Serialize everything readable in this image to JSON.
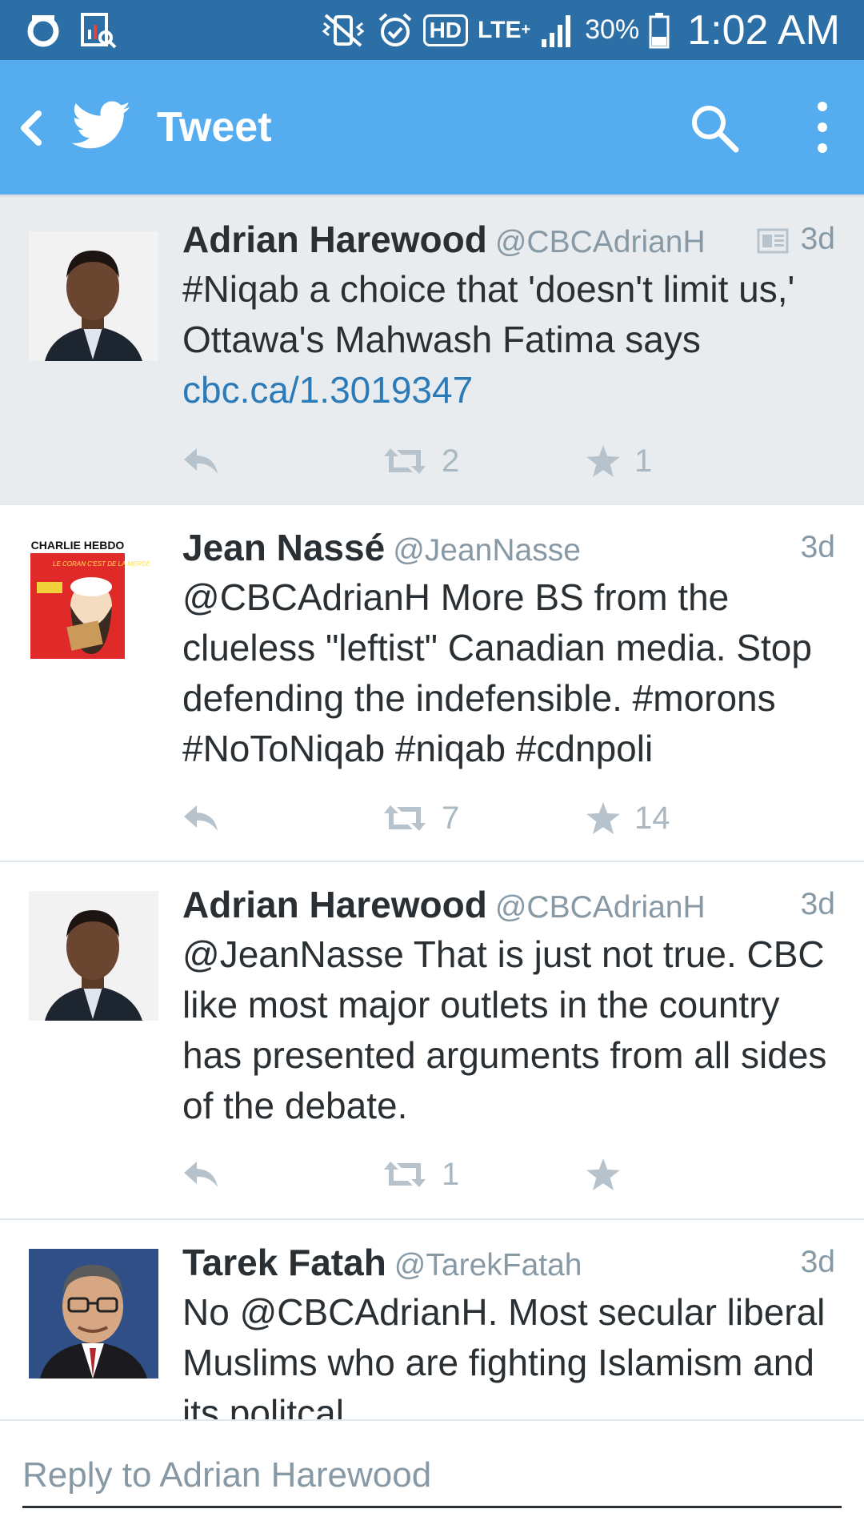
{
  "status_bar": {
    "hd_label": "HD",
    "network_label": "LTE",
    "network_sup": "+",
    "battery_percent": "30%",
    "battery_level": 0.3,
    "clock": "1:02 AM"
  },
  "app_bar": {
    "title": "Tweet",
    "back_icon": "chevron-left-icon",
    "logo_icon": "twitter-bird-icon",
    "search_icon": "search-icon",
    "menu_icon": "overflow-menu-icon",
    "background": "#55acee"
  },
  "tweets": [
    {
      "name": "Adrian Harewood",
      "handle": "@CBCAdrianH",
      "time": "3d",
      "text": "#Niqab a choice that 'doesn't limit us,' Ottawa's Mahwash Fatima says",
      "link": "cbc.ca/1.3019347",
      "retweets": "2",
      "favorites": "1",
      "avatar": "man-portrait-icon"
    },
    {
      "name": "Jean Nassé",
      "handle": "@JeanNasse",
      "time": "3d",
      "text": "@CBCAdrianH More BS from the clueless \"leftist\" Canadian media. Stop defending the indefensible. #morons #NoToNiqab #niqab #cdnpoli",
      "retweets": "7",
      "favorites": "14",
      "avatar": "magazine-cover-icon",
      "avatar_masthead": "CHARLIE HEBDO",
      "avatar_caption": "LE CORAN C'EST DE LA MERDE"
    },
    {
      "name": "Adrian Harewood",
      "handle": "@CBCAdrianH",
      "time": "3d",
      "text": "@JeanNasse That is just not true. CBC like most major outlets in the country has presented arguments from all sides of the debate.",
      "retweets": "1",
      "favorites": "",
      "avatar": "man-portrait-icon"
    },
    {
      "name": "Tarek Fatah",
      "handle": "@TarekFatah",
      "time": "3d",
      "text": "No @CBCAdrianH. Most secular liberal Muslims who are fighting Islamism and its politcal",
      "avatar": "man-with-glasses-portrait-icon"
    }
  ],
  "reply": {
    "placeholder": "Reply to Adrian Harewood",
    "value": ""
  },
  "colors": {
    "accent": "#55acee",
    "status_bar": "#2c6fa6",
    "link": "#2b7bb9",
    "meta_text": "#8899a6",
    "focused_bg": "#e9ecef"
  }
}
